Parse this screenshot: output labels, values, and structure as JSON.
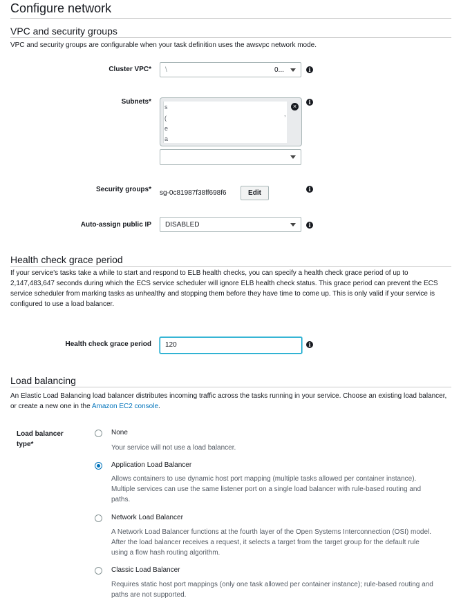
{
  "page_title": "Configure network",
  "vpc_section": {
    "title": "VPC and security groups",
    "description": "VPC and security groups are configurable when your task definition uses the awsvpc network mode.",
    "cluster_vpc": {
      "label": "Cluster VPC*",
      "value_start": "\\",
      "value_end": "0..."
    },
    "subnets": {
      "label": "Subnets*",
      "lines": [
        "s",
        "(",
        "e",
        "a"
      ],
      "tail_char": ","
    },
    "security_groups": {
      "label": "Security groups*",
      "value": "sg-0c81987f38ff698f6",
      "edit_label": "Edit"
    },
    "auto_assign_ip": {
      "label": "Auto-assign public IP",
      "value": "DISABLED"
    }
  },
  "health_section": {
    "title": "Health check grace period",
    "description": "If your service's tasks take a while to start and respond to ELB health checks, you can specify a health check grace period of up to 2,147,483,647 seconds during which the ECS service scheduler will ignore ELB health check status. This grace period can prevent the ECS service scheduler from marking tasks as unhealthy and stopping them before they have time to come up. This is only valid if your service is configured to use a load balancer.",
    "field_label": "Health check grace period",
    "field_value": "120"
  },
  "lb_section": {
    "title": "Load balancing",
    "description_before_link": "An Elastic Load Balancing load balancer distributes incoming traffic across the tasks running in your service. Choose an existing load balancer, or create a new one in the ",
    "link_text": "Amazon EC2 console",
    "description_after_link": ".",
    "type_label": "Load balancer type*",
    "options": [
      {
        "label": "None",
        "description": "Your service will not use a load balancer.",
        "selected": false
      },
      {
        "label": "Application Load Balancer",
        "description": "Allows containers to use dynamic host port mapping (multiple tasks allowed per container instance). Multiple services can use the same listener port on a single load balancer with rule-based routing and paths.",
        "selected": true
      },
      {
        "label": "Network Load Balancer",
        "description": "A Network Load Balancer functions at the fourth layer of the Open Systems Interconnection (OSI) model. After the load balancer receives a request, it selects a target from the target group for the default rule using a flow hash routing algorithm.",
        "selected": false
      },
      {
        "label": "Classic Load Balancer",
        "description": "Requires static host port mappings (only one task allowed per container instance); rule-based routing and paths are not supported.",
        "selected": false
      }
    ]
  },
  "icons": {
    "info": "info-icon",
    "clear": "clear-icon",
    "caret": "caret-down-icon"
  },
  "colors": {
    "accent": "#0073bb",
    "focus": "#00a1c9",
    "text": "#16191f",
    "muted": "#545b64"
  }
}
